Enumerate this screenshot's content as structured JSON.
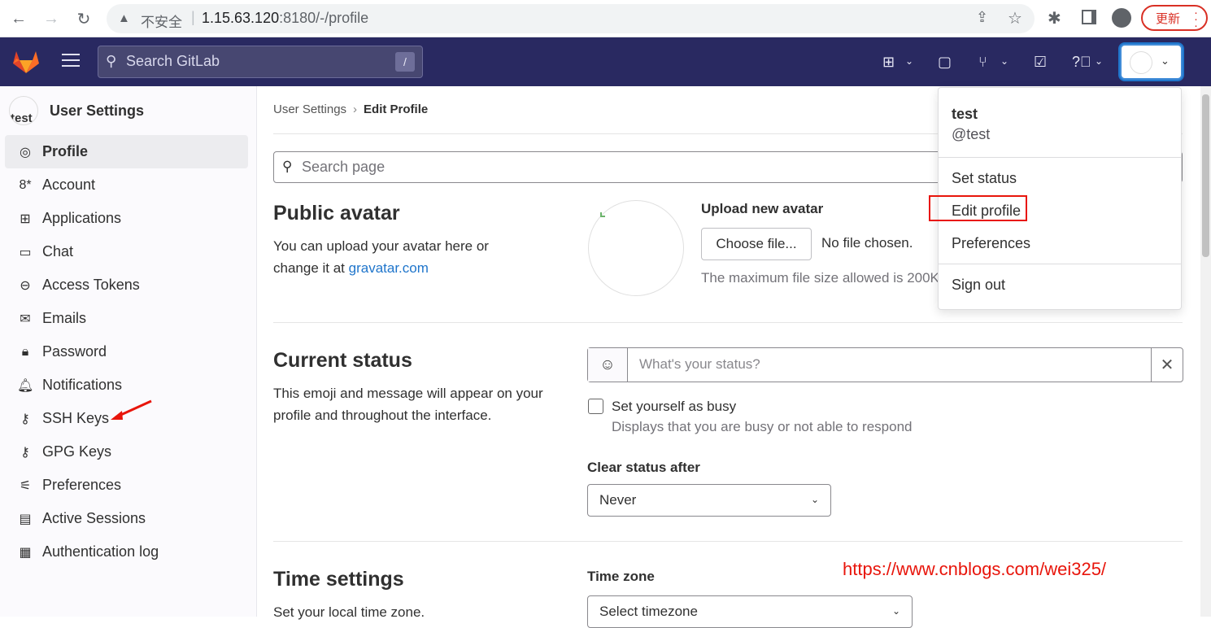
{
  "browser": {
    "insecure_label": "不安全",
    "separator": "|",
    "host": "1.15.63.120",
    "path": ":8180/-/profile",
    "update_label": "更新"
  },
  "header": {
    "search_placeholder": "Search GitLab",
    "search_shortcut": "/"
  },
  "sidebar": {
    "avatar_text": "test",
    "title": "User Settings",
    "items": [
      {
        "label": "Profile",
        "icon": "user-circle-icon"
      },
      {
        "label": "Account",
        "icon": "account-gear-icon"
      },
      {
        "label": "Applications",
        "icon": "applications-grid-icon"
      },
      {
        "label": "Chat",
        "icon": "chat-bubble-icon"
      },
      {
        "label": "Access Tokens",
        "icon": "token-icon"
      },
      {
        "label": "Emails",
        "icon": "envelope-icon"
      },
      {
        "label": "Password",
        "icon": "lock-icon"
      },
      {
        "label": "Notifications",
        "icon": "bell-icon"
      },
      {
        "label": "SSH Keys",
        "icon": "key-icon"
      },
      {
        "label": "GPG Keys",
        "icon": "key-icon"
      },
      {
        "label": "Preferences",
        "icon": "preferences-icon"
      },
      {
        "label": "Active Sessions",
        "icon": "monitor-icon"
      },
      {
        "label": "Authentication log",
        "icon": "log-icon"
      }
    ]
  },
  "main": {
    "breadcrumb": {
      "parent": "User Settings",
      "current": "Edit Profile"
    },
    "search_placeholder": "Search page",
    "avatar_section": {
      "title": "Public avatar",
      "desc_prefix": "You can upload your avatar here or change it at ",
      "link": "gravatar.com",
      "upload_label": "Upload new avatar",
      "choose_button": "Choose file...",
      "no_file": "No file chosen.",
      "max_size": "The maximum file size allowed is 200KiB."
    },
    "status_section": {
      "title": "Current status",
      "desc": "This emoji and message will appear on your profile and throughout the interface.",
      "status_placeholder": "What's your status?",
      "busy_label": "Set yourself as busy",
      "busy_help": "Displays that you are busy or not able to respond",
      "clear_label": "Clear status after",
      "clear_value": "Never"
    },
    "time_section": {
      "title": "Time settings",
      "desc": "Set your local time zone.",
      "tz_label": "Time zone",
      "tz_value": "Select timezone"
    }
  },
  "dropdown": {
    "name": "test",
    "handle": "@test",
    "items": [
      "Set status",
      "Edit profile",
      "Preferences",
      "Sign out"
    ]
  },
  "watermark": "https://www.cnblogs.com/wei325/",
  "colors": {
    "header_bg": "#292961",
    "link": "#1f75cb",
    "annotation_red": "#e8150b"
  }
}
